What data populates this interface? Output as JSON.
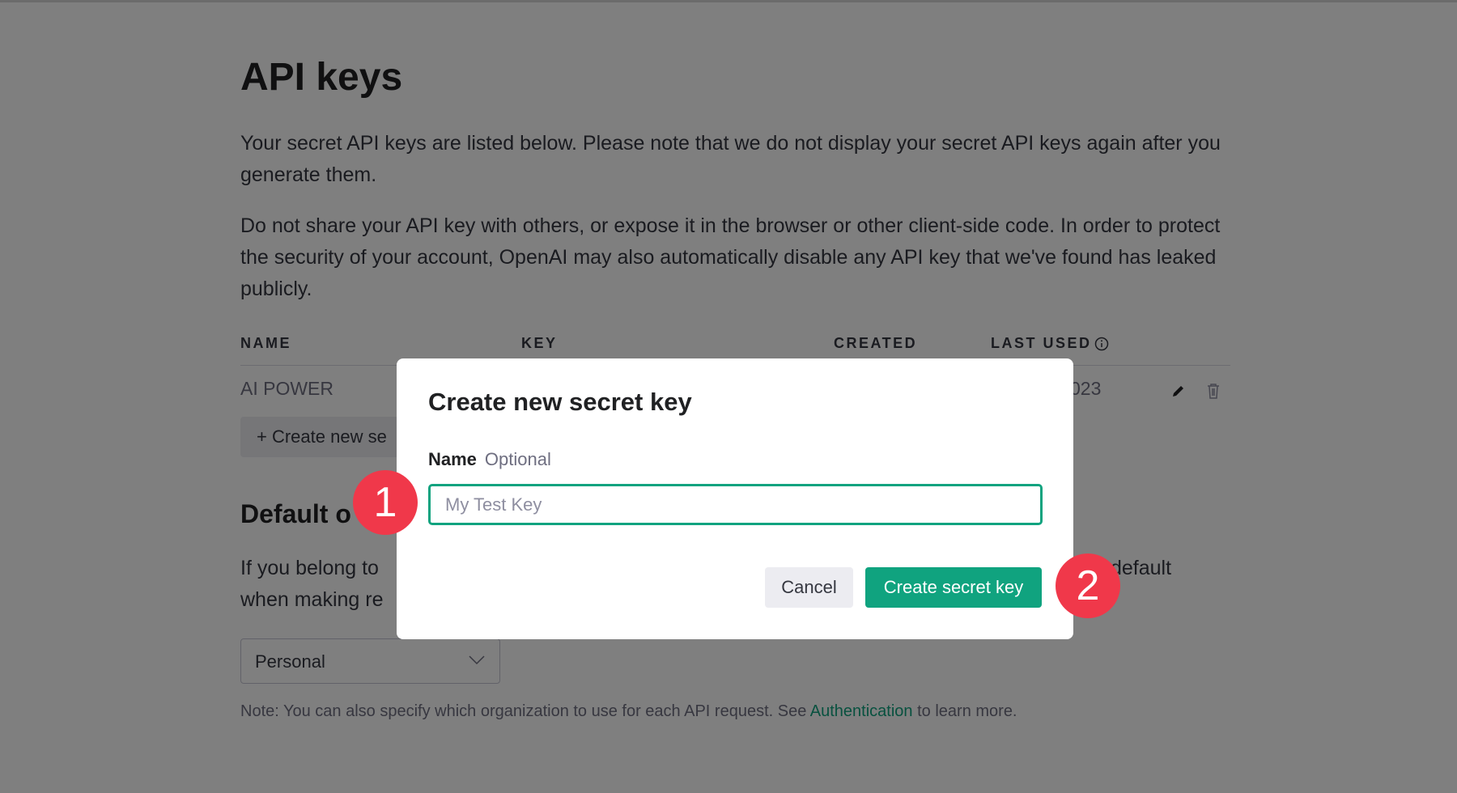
{
  "page": {
    "title": "API keys",
    "intro": "Your secret API keys are listed below. Please note that we do not display your secret API keys again after you generate them.",
    "warning": "Do not share your API key with others, or expose it in the browser or other client-side code. In order to protect the security of your account, OpenAI may also automatically disable any API key that we've found has leaked publicly.",
    "table": {
      "headers": [
        "NAME",
        "KEY",
        "CREATED",
        "LAST USED"
      ],
      "rows": [
        {
          "name": "AI POWER",
          "last_used_partial": "023"
        }
      ]
    },
    "create_button_visible": "Create new se",
    "default_org_heading": "Default o",
    "default_org_text_left_1": "If you belong to",
    "default_org_text_right_1": "default",
    "default_org_text_left_2": "when making re",
    "org_select": "Personal",
    "note_prefix": "Note: You can also specify which organization to use for each API request. See ",
    "note_link": "Authentication",
    "note_suffix": " to learn more."
  },
  "modal": {
    "title": "Create new secret key",
    "name_label": "Name",
    "optional_label": "Optional",
    "name_placeholder": "My Test Key",
    "cancel_label": "Cancel",
    "submit_label": "Create secret key"
  },
  "annotations": {
    "step1": "1",
    "step2": "2"
  },
  "colors": {
    "accent": "#10a37f",
    "badge": "#f0384a"
  }
}
